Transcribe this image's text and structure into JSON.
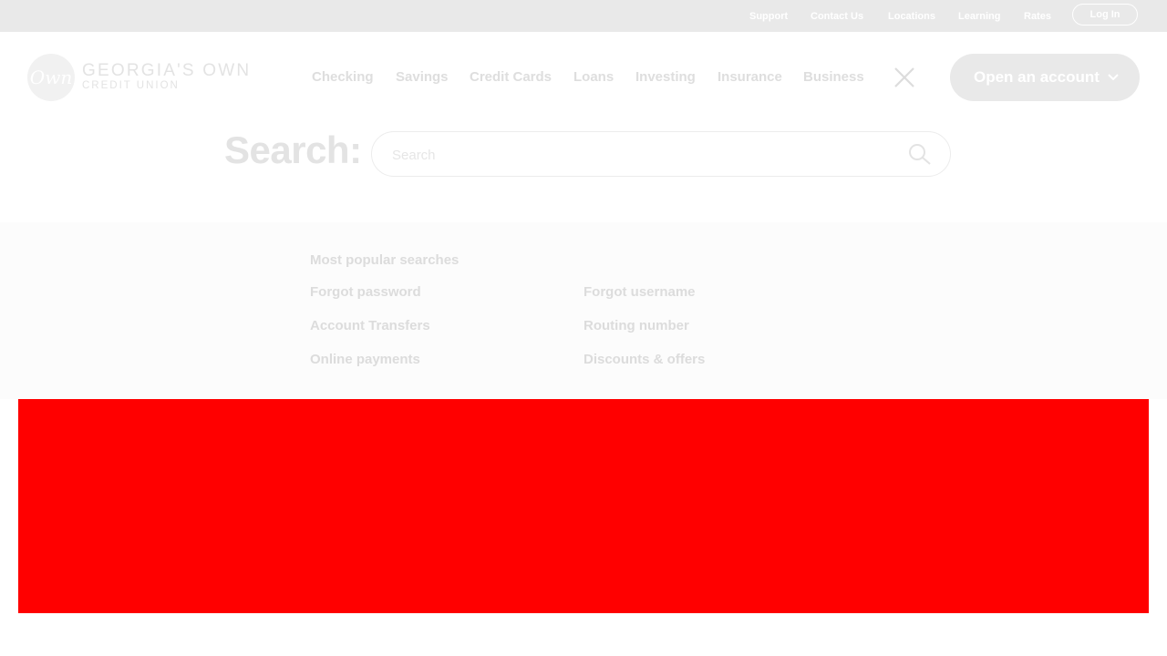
{
  "utility_nav": {
    "links": [
      "Support",
      "Contact Us",
      "Locations",
      "Learning",
      "Rates"
    ],
    "login_label": "Log In"
  },
  "logo": {
    "mark": "Own",
    "name": "GEORGIA'S OWN",
    "subtitle": "CREDIT UNION"
  },
  "main_nav": {
    "items": [
      "Checking",
      "Savings",
      "Credit Cards",
      "Loans",
      "Investing",
      "Insurance",
      "Business"
    ],
    "close_icon": "close-icon",
    "cta_label": "Open an account",
    "cta_icon": "chevron-down-icon"
  },
  "search": {
    "heading": "Search:",
    "placeholder": "Search",
    "value": "",
    "icon": "search-icon"
  },
  "popular": {
    "title": "Most popular searches",
    "links": [
      "Forgot password",
      "Forgot username",
      "Account Transfers",
      "Routing number",
      "Online payments",
      "Discounts & offers"
    ]
  },
  "colors": {
    "utility_bar": "#e9e9e9",
    "overlay_block": "#ff0000"
  }
}
